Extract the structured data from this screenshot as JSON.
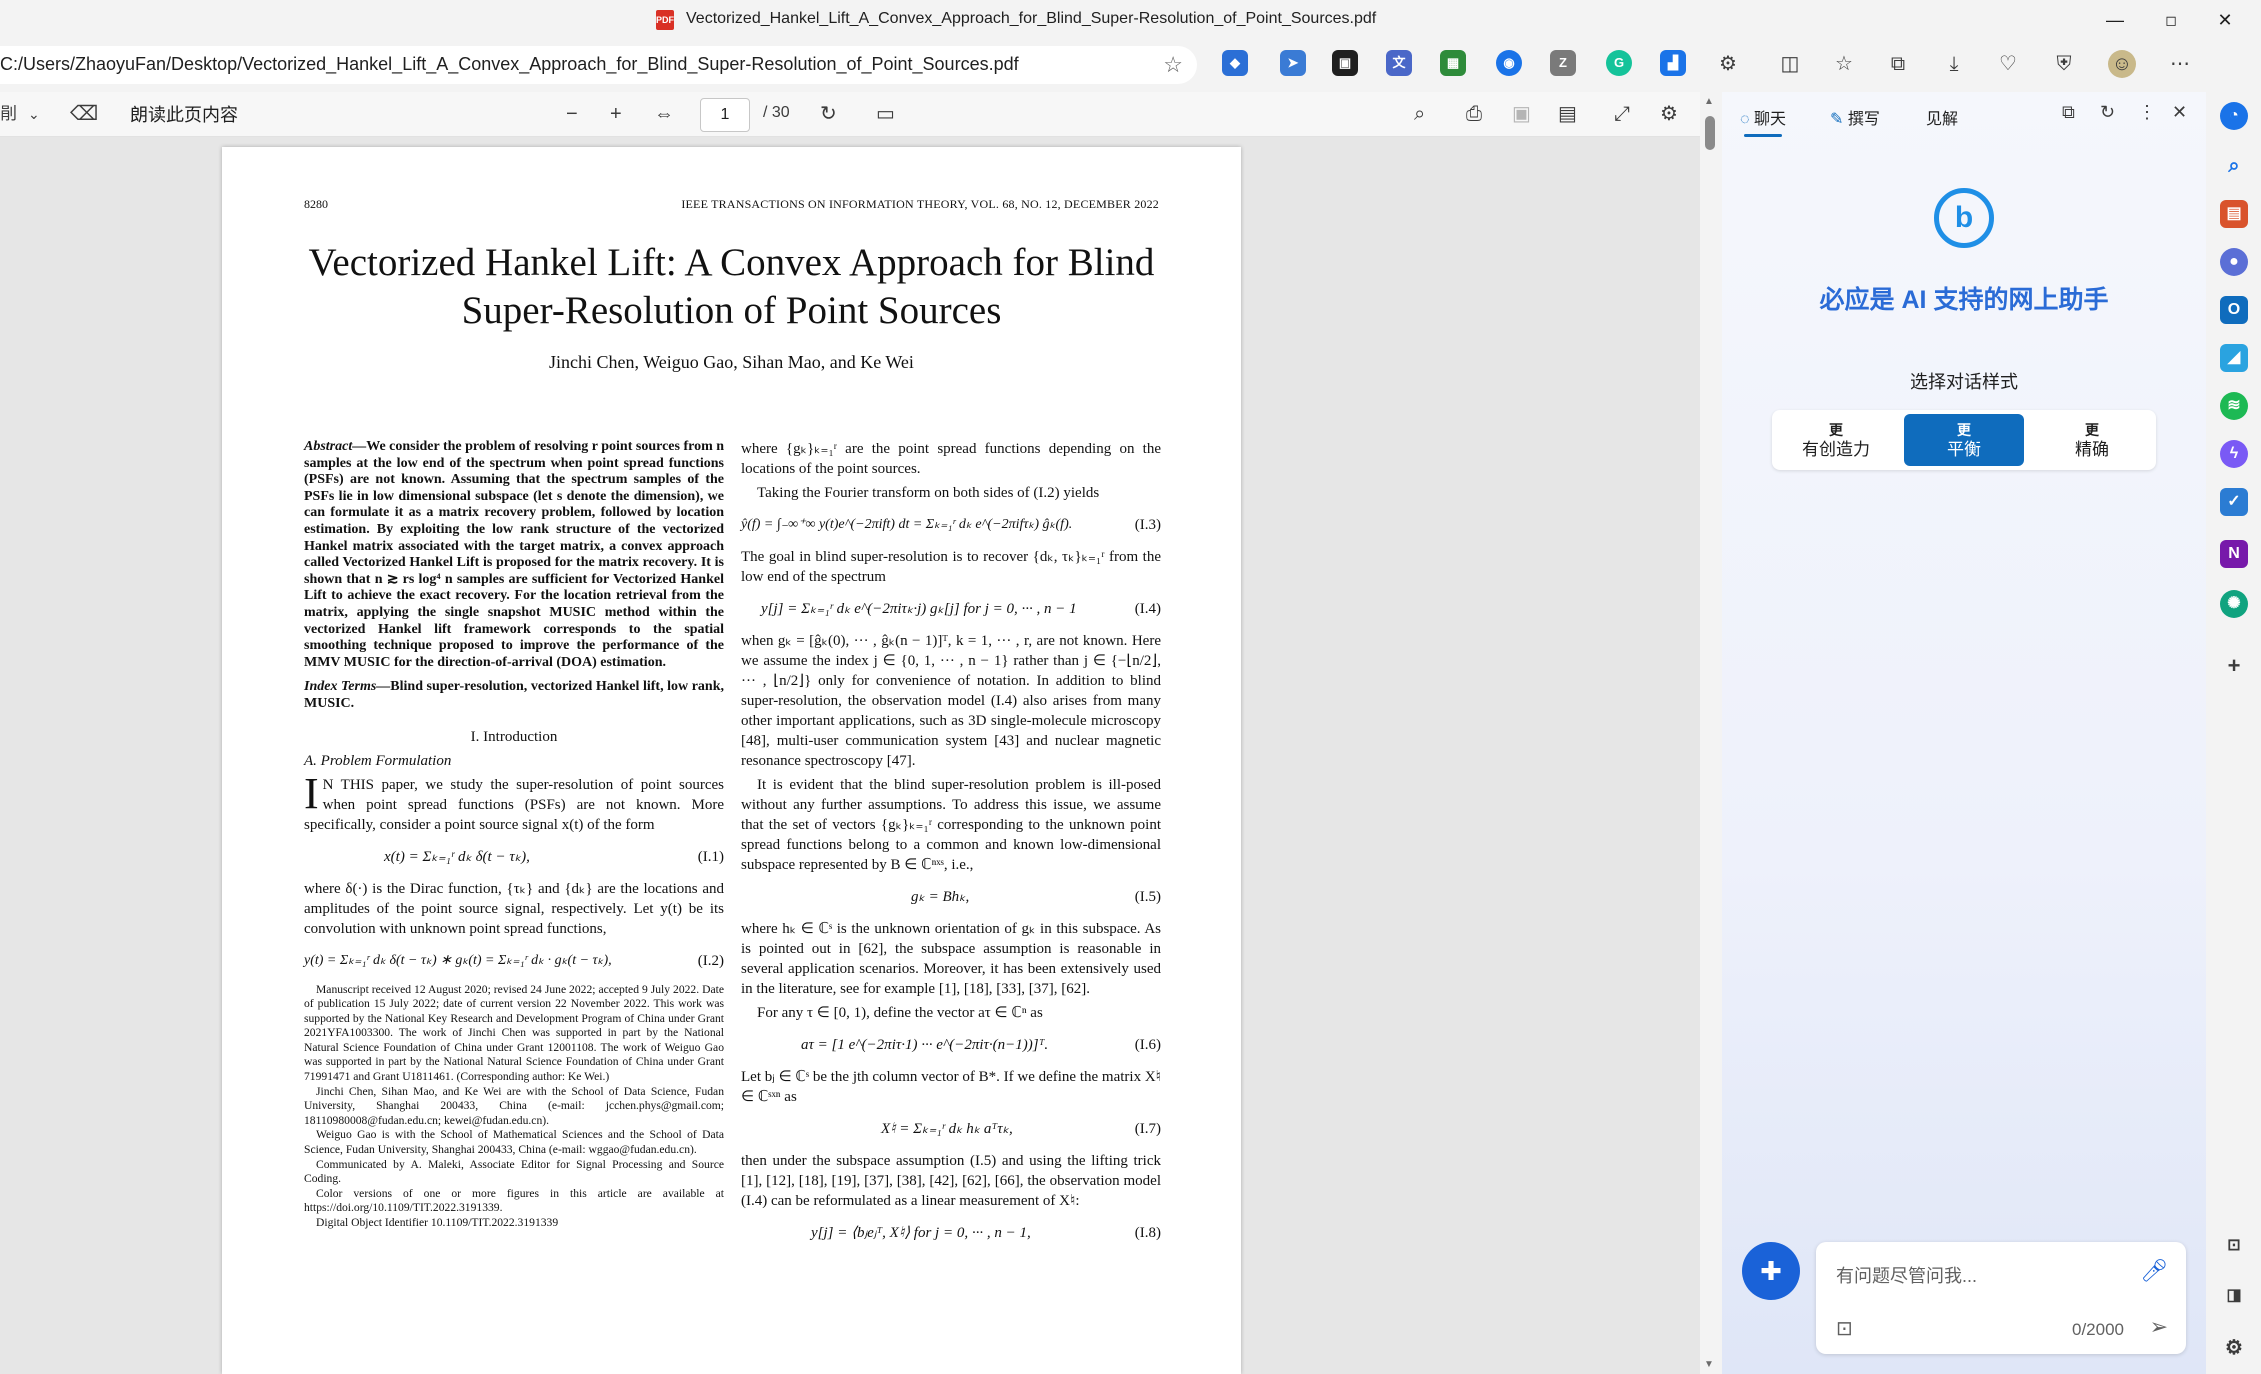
{
  "window": {
    "title": "Vectorized_Hankel_Lift_A_Convex_Approach_for_Blind_Super-Resolution_of_Point_Sources.pdf",
    "pdf_icon": "PDF",
    "minimize": "—",
    "maximize": "◻",
    "close": "✕"
  },
  "address": {
    "url": "C:/Users/ZhaoyuFan/Desktop/Vectorized_Hankel_Lift_A_Convex_Approach_for_Blind_Super-Resolution_of_Point_Sources.pdf",
    "favorite_icon": "star-icon"
  },
  "pdf_toolbar": {
    "draw_label": "剈",
    "read_aloud": "朗读此页内容",
    "page_current": "1",
    "page_total": "/ 30"
  },
  "paper": {
    "page_number": "8280",
    "journal": "IEEE TRANSACTIONS ON INFORMATION THEORY, VOL. 68, NO. 12, DECEMBER 2022",
    "title": "Vectorized Hankel Lift: A Convex Approach for Blind Super-Resolution of Point Sources",
    "authors": "Jinchi Chen, Weiguo Gao, Sihan Mao, and Ke Wei",
    "abstract_label": "Abstract—",
    "abstract": "We consider the problem of resolving r point sources from n samples at the low end of the spectrum when point spread functions (PSFs) are not known. Assuming that the spectrum samples of the PSFs lie in low dimensional subspace (let s denote the dimension), we can formulate it as a matrix recovery problem, followed by location estimation. By exploiting the low rank structure of the vectorized Hankel matrix associated with the target matrix, a convex approach called Vectorized Hankel Lift is proposed for the matrix recovery. It is shown that n ≳ rs log⁴ n samples are sufficient for Vectorized Hankel Lift to achieve the exact recovery. For the location retrieval from the matrix, applying the single snapshot MUSIC method within the vectorized Hankel lift framework corresponds to the spatial smoothing technique proposed to improve the performance of the MMV MUSIC for the direction-of-arrival (DOA) estimation.",
    "index_label": "Index Terms—",
    "index_terms": "Blind super-resolution, vectorized Hankel lift, low rank, MUSIC.",
    "section1": "I. Introduction",
    "subsectionA": "A. Problem Formulation",
    "dropcap": "I",
    "intro_p1": "N THIS paper, we study the super-resolution of point sources when point spread functions (PSFs) are not known. More specifically, consider a point source signal x(t) of the form",
    "eq1": "x(t) = Σₖ₌₁ʳ dₖ δ(t − τₖ),",
    "eq1_num": "(I.1)",
    "intro_p2": "where δ(·) is the Dirac function, {τₖ} and {dₖ} are the locations and amplitudes of the point source signal, respectively. Let y(t) be its convolution with unknown point spread functions,",
    "eq2": "y(t) = Σₖ₌₁ʳ dₖ δ(t − τₖ) ∗ gₖ(t) = Σₖ₌₁ʳ dₖ · gₖ(t − τₖ),",
    "eq2_num": "(I.2)",
    "footnotes": [
      "Manuscript received 12 August 2020; revised 24 June 2022; accepted 9 July 2022. Date of publication 15 July 2022; date of current version 22 November 2022. This work was supported by the National Key Research and Development Program of China under Grant 2021YFA1003300. The work of Jinchi Chen was supported in part by the National Natural Science Foundation of China under Grant 12001108. The work of Weiguo Gao was supported in part by the National Natural Science Foundation of China under Grant 71991471 and Grant U1811461. (Corresponding author: Ke Wei.)",
      "Jinchi Chen, Sihan Mao, and Ke Wei are with the School of Data Science, Fudan University, Shanghai 200433, China (e-mail: jcchen.phys@gmail.com; 18110980008@fudan.edu.cn; kewei@fudan.edu.cn).",
      "Weiguo Gao is with the School of Mathematical Sciences and the School of Data Science, Fudan University, Shanghai 200433, China (e-mail: wggao@fudan.edu.cn).",
      "Communicated by A. Maleki, Associate Editor for Signal Processing and Source Coding.",
      "Color versions of one or more figures in this article are available at https://doi.org/10.1109/TIT.2022.3191339.",
      "Digital Object Identifier 10.1109/TIT.2022.3191339"
    ],
    "r_p1": "where {gₖ}ₖ₌₁ʳ are the point spread functions depending on the locations of the point sources.",
    "r_p2": "Taking the Fourier transform on both sides of (I.2) yields",
    "eq3": "ŷ(f) = ∫₋∞⁺∞ y(t)e^(−2πift) dt = Σₖ₌₁ʳ dₖ e^(−2πifτₖ) ĝₖ(f).",
    "eq3_num": "(I.3)",
    "r_p3": "The goal in blind super-resolution is to recover {dₖ, τₖ}ₖ₌₁ʳ from the low end of the spectrum",
    "eq4": "y[j] = Σₖ₌₁ʳ dₖ e^(−2πiτₖ·j) gₖ[j]   for j = 0, ··· , n − 1",
    "eq4_num": "(I.4)",
    "r_p4": "when gₖ = [ĝₖ(0), ··· , ĝₖ(n − 1)]ᵀ, k = 1, ··· , r, are not known. Here we assume the index j ∈ {0, 1, ··· , n − 1} rather than j ∈ {−⌊n/2⌋, ··· , ⌊n/2⌋} only for convenience of notation. In addition to blind super-resolution, the observation model (I.4) also arises from many other important applications, such as 3D single-molecule microscopy [48], multi-user communication system [43] and nuclear magnetic resonance spectroscopy [47].",
    "r_p5": "It is evident that the blind super-resolution problem is ill-posed without any further assumptions. To address this issue, we assume that the set of vectors {gₖ}ₖ₌₁ʳ corresponding to the unknown point spread functions belong to a common and known low-dimensional subspace represented by B ∈ ℂⁿˣˢ, i.e.,",
    "eq5": "gₖ = Bhₖ,",
    "eq5_num": "(I.5)",
    "r_p6": "where hₖ ∈ ℂˢ is the unknown orientation of gₖ in this subspace. As is pointed out in [62], the subspace assumption is reasonable in several application scenarios. Moreover, it has been extensively used in the literature, see for example [1], [18], [33], [37], [62].",
    "r_p7": "For any τ ∈ [0, 1), define the vector aτ ∈ ℂⁿ as",
    "eq6": "aτ = [1   e^(−2πiτ·1)   ···   e^(−2πiτ·(n−1))]ᵀ.",
    "eq6_num": "(I.6)",
    "r_p8": "Let bⱼ ∈ ℂˢ be the jth column vector of B*. If we define the matrix X♮ ∈ ℂˢˣⁿ as",
    "eq7": "X♮ = Σₖ₌₁ʳ dₖ hₖ aᵀτₖ,",
    "eq7_num": "(I.7)",
    "r_p9": "then under the subspace assumption (I.5) and using the lifting trick [1], [12], [18], [19], [37], [38], [42], [62], [66], the observation model (I.4) can be reformulated as a linear measurement of X♮:",
    "eq8": "y[j] = ⟨bⱼeⱼᵀ, X♮⟩ for j = 0, ··· , n − 1,",
    "eq8_num": "(I.8)"
  },
  "copilot": {
    "tab_chat": "聊天",
    "tab_compose": "撰写",
    "tab_insights": "见解",
    "heading": "必应是 AI 支持的网上助手",
    "style_label": "选择对话样式",
    "styles": [
      {
        "top": "更",
        "label": "有创造力"
      },
      {
        "top": "更",
        "label": "平衡"
      },
      {
        "top": "更",
        "label": "精确"
      }
    ],
    "input_placeholder": "有问题尽管问我...",
    "char_count": "0/2000",
    "accent": "#0f6cbd"
  }
}
